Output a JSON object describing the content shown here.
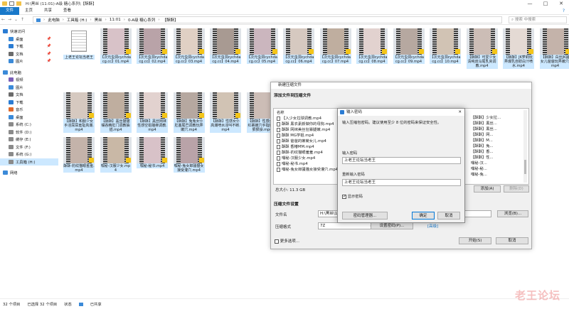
{
  "window": {
    "title": "H:\\黑丝 (11:01)-A级 糖心系列\\【酥酥】",
    "controls": [
      "—",
      "□",
      "✕"
    ]
  },
  "ribbon": {
    "tabs": [
      "文件",
      "主页",
      "共享",
      "查看"
    ],
    "help": "?"
  },
  "address": {
    "crumbs": [
      "此电脑",
      "工具箱 (H:)",
      "黑丝",
      "11:01",
      "0-A级 糖心系列",
      "【酥酥】"
    ],
    "search_placeholder": "搜索\"【酥酥】\"",
    "search_text": "搜索 中搜索"
  },
  "nav": {
    "items": [
      {
        "label": "快速访问",
        "hdr": true,
        "color": "#2b7cd3"
      },
      {
        "label": "桌面",
        "color": "#3b8ad8",
        "pin": true
      },
      {
        "label": "下载",
        "color": "#2b7cd3",
        "pin": true
      },
      {
        "label": "文档",
        "color": "#6b6b6b",
        "pin": true
      },
      {
        "label": "图片",
        "color": "#3b8ad8",
        "pin": true
      },
      {
        "label": "此电脑",
        "hdr": true,
        "color": "#3b8ad8"
      },
      {
        "label": "视频",
        "color": "#7a5fb8"
      },
      {
        "label": "图片",
        "color": "#3b8ad8"
      },
      {
        "label": "文档",
        "color": "#6b6b6b"
      },
      {
        "label": "下载",
        "color": "#2b7cd3"
      },
      {
        "label": "音乐",
        "color": "#e06a2b"
      },
      {
        "label": "桌面",
        "color": "#3b8ad8"
      },
      {
        "label": "系统 (C:)",
        "color": "#8a8a8a"
      },
      {
        "label": "软件 (D:)",
        "color": "#8a8a8a"
      },
      {
        "label": "缓存 (E:)",
        "color": "#8a8a8a"
      },
      {
        "label": "文件 (F:)",
        "color": "#8a8a8a"
      },
      {
        "label": "系统 (G:)",
        "color": "#8a8a8a"
      },
      {
        "label": "工具箱 (H:)",
        "color": "#8a8a8a",
        "sel": true
      },
      {
        "label": "网络",
        "hdr": true,
        "color": "#3b8ad8"
      }
    ]
  },
  "files": {
    "row1": [
      "上老王论坛当老王",
      "【次元虫洞cychdacg.cc】01.mp4",
      "【次元虫洞cychdacg.cc】02.mp4",
      "【次元虫洞cychdacg.cc】03.mp4",
      "【次元虫洞cychdacg.cc】04.mp4",
      "【次元虫洞cychdacg.cc】05.mp4",
      "【次元虫洞cychdacg.cc】06.mp4",
      "【次元虫洞cychdacg.cc】07.mp4",
      "【次元虫洞cychdacg.cc】08.mp4",
      "【次元虫洞cychdacg.cc】09.mp4",
      "【次元虫洞cychdacg.cc】10.mp4",
      "【酥酥】可爱少女清纯双马尾乳夹调教.mp4",
      "【酥酥】JK萝莉玩弄爆乳自慰白汁喷水.mp4",
      "【酥酥】白丝JK骚女儿爸爸玩弄嫩穴.mp4"
    ],
    "row2": [
      "【酥酥】和服少女手淫尿尿羞耻高潮.mp4",
      "【酥酥】黑丝猫猫嘴吞精肛门调教抽插.mp4",
      "【酥酥】黑丝网袜性感空姐捆绑调教.mp4",
      "【酥酥】兔兔女仆肛塞尾巴调教玩弄嫩穴.mp4",
      "【酥酥】性感女仆高潮喷水淫叫不断.mp4",
      "【酥酥】性感女儿红裹嫩穴手指爸爸狠狠操.mp4",
      "酥酥 香椿MM.mp4"
    ],
    "row3": [
      "酥酥-豹纹猫眼羞羞.mp4",
      "嘿秘-汉服少女.mp4",
      "嘿秘-秘书.mp4",
      "嘿秘-兔女郎骚猫女接受灌穴.mp4"
    ]
  },
  "status": {
    "count": "32 个项目",
    "selected": "已选择 32 个项目",
    "state": "状态",
    "share": "已共享"
  },
  "compress_dialog": {
    "title": "新建压缩文件",
    "add_title": "添加文件到压缩文件",
    "col_name": "名称",
    "col_rows_left": [
      "【入少女拉球调教.mp4",
      "酥酥 黑衣素颜做你的母狗.mp4",
      "酥酥 网袜美丝狂暴腿嫩.mp4",
      "酥酥 MG学姐.mp4",
      "酥酥 爸爸的嫩菊女儿.mp4",
      "酥酥 香椿MM.mp4",
      "酥酥-豹纹猫眼羞羞.mp4",
      "嘿秘-汉服少女.mp4",
      "嘿秘-秘书.mp4",
      "嘿秘-兔女郎骚猫女接受灌穴.mp4"
    ],
    "col_rows_right": [
      "【酥酥】少女拉...",
      "【酥酥】黑丝...",
      "【酥酥】黑丝...",
      "【酥酥】网...",
      "【酥酥】M...",
      "【酥酥】兔...",
      "【酥酥】香...",
      "【酥酥】性...",
      "嘿秘-汉...",
      "嘿秘-秘...",
      "嘿秘-兔..."
    ],
    "total": "总大小: 11.3 GB",
    "add_btn": "添加(A)",
    "del_btn": "删除(D)",
    "settings_title": "压缩文件设置",
    "name_label": "文件名",
    "name_value": "H:\\黑丝\\1...",
    "browse_btn": "浏览(B)...",
    "format_label": "压缩格式",
    "format_value": "7Z",
    "password_btn": "设置密码(P)...",
    "advanced_link": "[高级]",
    "more_label": "更多选项...",
    "start_btn": "开始(S)",
    "cancel_btn": "取消"
  },
  "password_dialog": {
    "title": "输入密码",
    "desc": "输入压缩包密码。建议使用至少 8 位的密码来保证安全性。",
    "label1": "输入密码",
    "value1": "上老王论坛当老王",
    "label2": "重新输入密码",
    "value2": "上老王论坛当老王",
    "show_password": "显示密码",
    "manager_btn": "密码管理器...",
    "ok_btn": "确定",
    "cancel_btn": "取消"
  },
  "watermark": "老王论坛"
}
